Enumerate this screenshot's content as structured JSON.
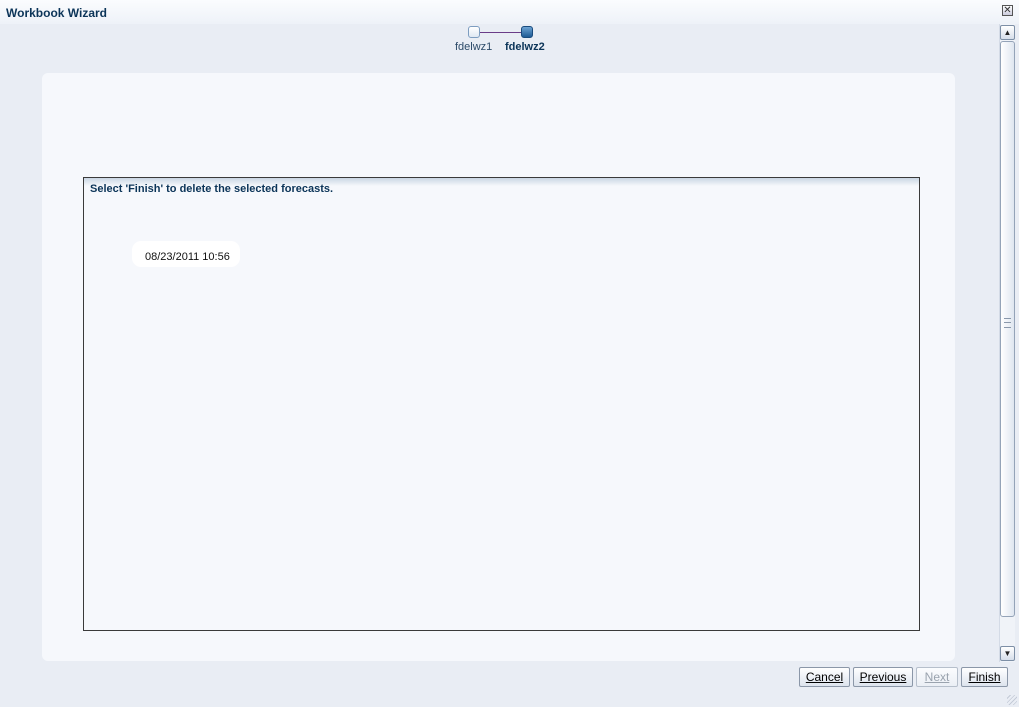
{
  "window": {
    "title": "Workbook Wizard",
    "close_glyph": "✕"
  },
  "train": {
    "steps": [
      {
        "label": "fdelwz1",
        "state": "visited"
      },
      {
        "label": "fdelwz2",
        "state": "current"
      }
    ]
  },
  "content": {
    "message": "Select 'Finish' to delete the selected forecasts.",
    "items": [
      "08/23/2011 10:56"
    ]
  },
  "scrollbar": {
    "up_glyph": "▲",
    "down_glyph": "▼"
  },
  "buttons": {
    "cancel": "Cancel",
    "previous": "Previous",
    "next": "Next",
    "finish": "Finish"
  },
  "colors": {
    "title": "#0b3458",
    "accent": "#1d5a94",
    "background": "#e9edf4"
  }
}
